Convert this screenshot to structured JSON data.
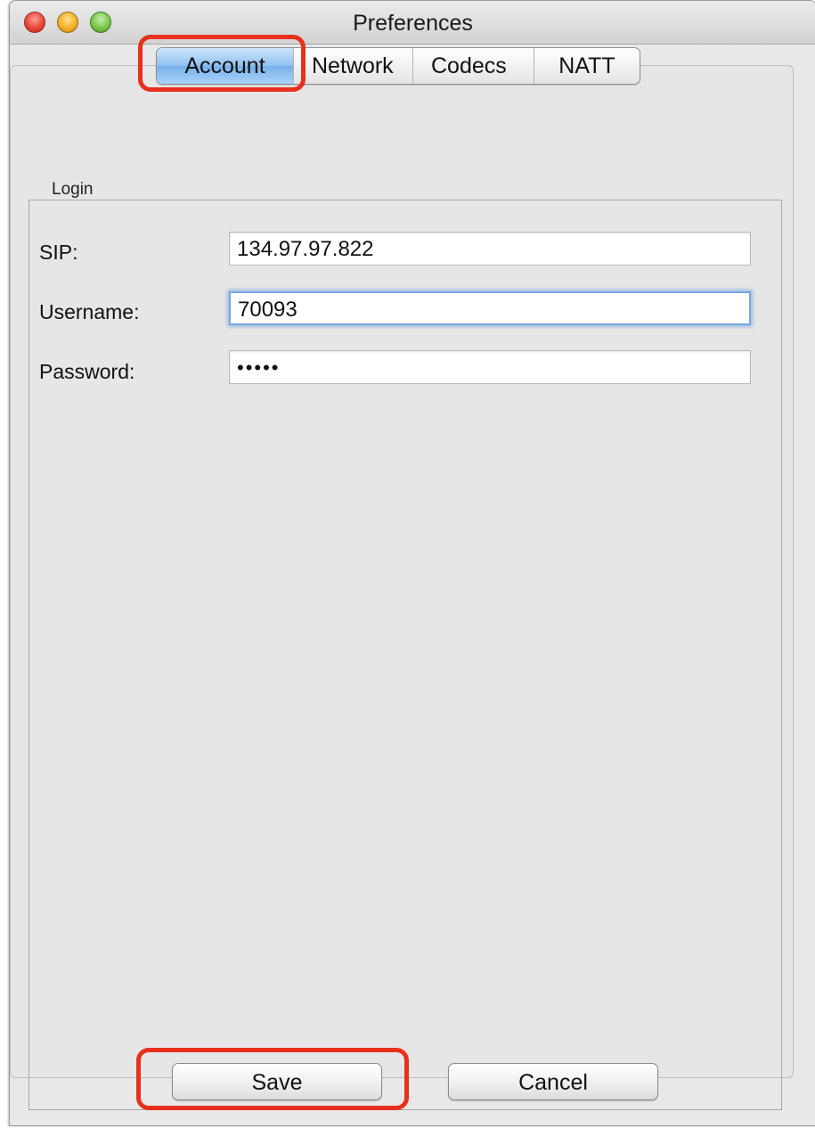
{
  "window": {
    "title": "Preferences"
  },
  "tabs": [
    {
      "label": "Account",
      "active": true
    },
    {
      "label": "Network",
      "active": false
    },
    {
      "label": "Codecs",
      "active": false
    },
    {
      "label": "NATT",
      "active": false
    }
  ],
  "login": {
    "legend": "Login",
    "sip_label": "SIP:",
    "sip_value": "134.97.97.822",
    "username_label": "Username:",
    "username_value": "70093",
    "password_label": "Password:",
    "password_value": "•••••"
  },
  "buttons": {
    "save": "Save",
    "cancel": "Cancel"
  },
  "colors": {
    "highlight": "#e8301c",
    "active_tab": "#8fc0f1",
    "focus_ring": "#7aa7de"
  }
}
